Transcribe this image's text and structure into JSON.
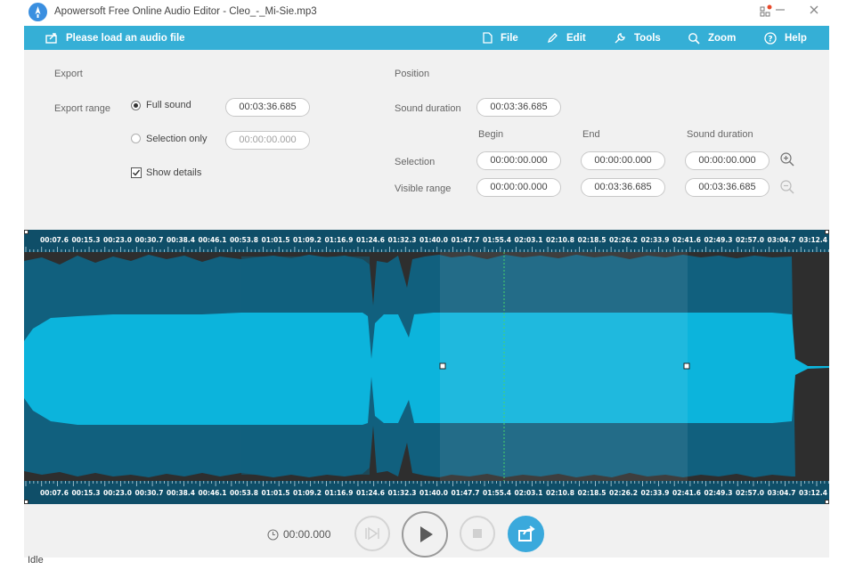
{
  "window": {
    "title": "Apowersoft Free Online Audio Editor - Cleo_-_Mi-Sie.mp3"
  },
  "toolbar": {
    "load_label": "Please load an audio file",
    "menus": [
      {
        "label": "File",
        "icon": "file-icon"
      },
      {
        "label": "Edit",
        "icon": "pencil-icon"
      },
      {
        "label": "Tools",
        "icon": "wrench-icon"
      },
      {
        "label": "Zoom",
        "icon": "magnifier-icon"
      },
      {
        "label": "Help",
        "icon": "help-icon"
      }
    ]
  },
  "export": {
    "heading": "Export",
    "range_label": "Export range",
    "full_sound_label": "Full sound",
    "full_sound_value": "00:03:36.685",
    "full_sound_selected": true,
    "selection_only_label": "Selection only",
    "selection_only_value": "00:00:00.000",
    "show_details_label": "Show details",
    "show_details_checked": true
  },
  "position": {
    "heading": "Position",
    "sound_duration_label": "Sound duration",
    "sound_duration_value": "00:03:36.685",
    "col_begin": "Begin",
    "col_end": "End",
    "col_duration": "Sound duration",
    "selection_label": "Selection",
    "selection_begin": "00:00:00.000",
    "selection_end": "00:00:00.000",
    "selection_duration": "00:00:00.000",
    "visible_label": "Visible range",
    "visible_begin": "00:00:00.000",
    "visible_end": "00:03:36.685",
    "visible_duration": "00:03:36.685"
  },
  "timeline": {
    "ticks": [
      "00:07.6",
      "00:15.3",
      "00:23.0",
      "00:30.7",
      "00:38.4",
      "00:46.1",
      "00:53.8",
      "01:01.5",
      "01:09.2",
      "01:16.9",
      "01:24.6",
      "01:32.3",
      "01:40.0",
      "01:47.7",
      "01:55.4",
      "02:03.1",
      "02:10.8",
      "02:18.5",
      "02:26.2",
      "02:33.9",
      "02:41.6",
      "02:49.3",
      "02:57.0",
      "03:04.7",
      "03:12.4"
    ]
  },
  "colors": {
    "accent": "#35afd6",
    "wave_light": "#0cb4dc",
    "wave_dark": "#11607e",
    "background_panel": "#f1f1f1",
    "share_button": "#3aa9dc"
  },
  "player": {
    "time": "00:00.000"
  },
  "status": {
    "text": "Idle"
  }
}
